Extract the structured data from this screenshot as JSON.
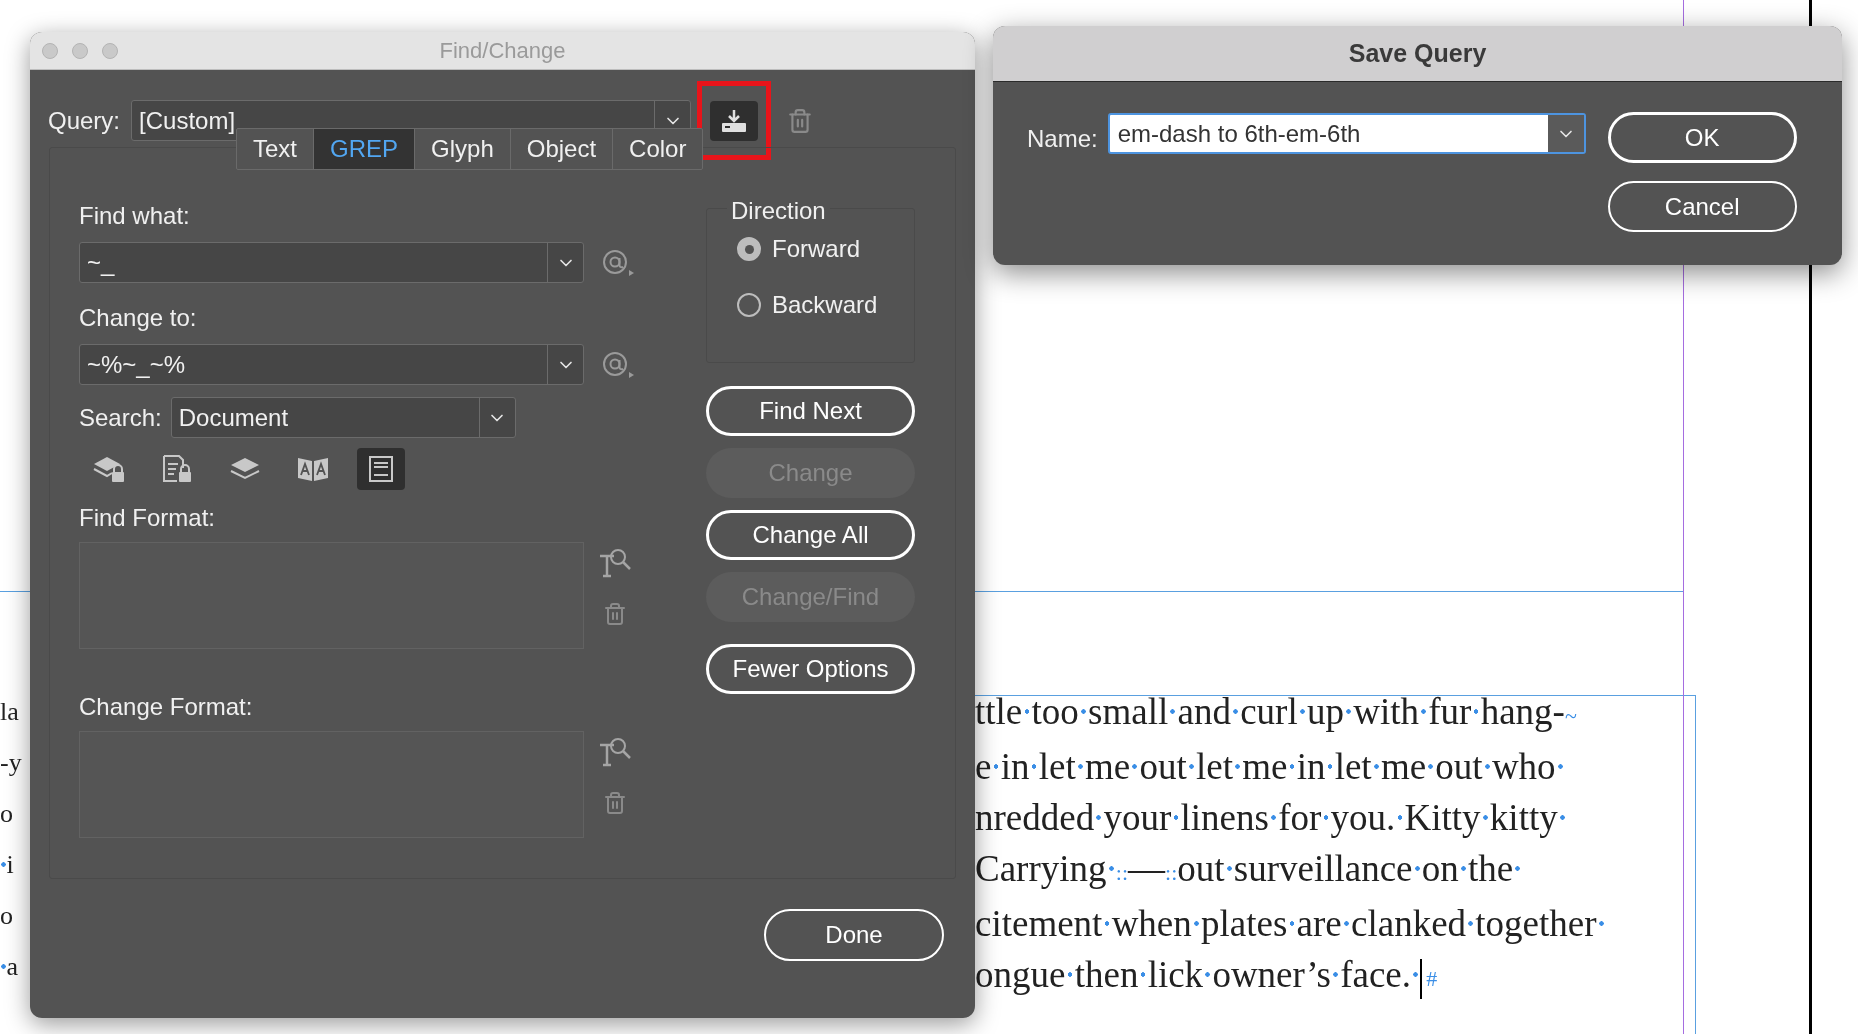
{
  "find_change": {
    "title": "Find/Change",
    "query": {
      "label": "Query:",
      "value": "[Custom]"
    },
    "save_button": {
      "highlighted": true
    },
    "tabs": [
      {
        "label": "Text",
        "selected": false
      },
      {
        "label": "GREP",
        "selected": true
      },
      {
        "label": "Glyph",
        "selected": false
      },
      {
        "label": "Object",
        "selected": false
      },
      {
        "label": "Color",
        "selected": false
      }
    ],
    "find_what": {
      "label": "Find what:",
      "value": "~_"
    },
    "change_to": {
      "label": "Change to:",
      "value": "~%~_~%"
    },
    "search": {
      "label": "Search:",
      "value": "Document"
    },
    "options": [
      {
        "kind": "lockedlayers",
        "selected": false
      },
      {
        "kind": "lockedstories",
        "selected": false
      },
      {
        "kind": "layers",
        "selected": false
      },
      {
        "kind": "masters",
        "selected": false
      },
      {
        "kind": "footnotes",
        "selected": true
      }
    ],
    "find_format": {
      "label": "Find Format:"
    },
    "change_format": {
      "label": "Change Format:"
    },
    "direction": {
      "label": "Direction",
      "options": [
        {
          "label": "Forward",
          "selected": true
        },
        {
          "label": "Backward",
          "selected": false
        }
      ]
    },
    "buttons": [
      {
        "label": "Find Next",
        "disabled": false
      },
      {
        "label": "Change",
        "disabled": true
      },
      {
        "label": "Change All",
        "disabled": false
      },
      {
        "label": "Change/Find",
        "disabled": true
      },
      {
        "label": "Fewer Options",
        "disabled": false
      }
    ],
    "done": "Done"
  },
  "save_query": {
    "title": "Save Query",
    "name_label": "Name:",
    "name_value": "em-dash to 6th-em-6th",
    "buttons": [
      "OK",
      "Cancel"
    ]
  },
  "document": {
    "left_lines": [
      {
        "parts": [
          {
            "kind": "word",
            "text": "la"
          }
        ]
      },
      {
        "parts": [
          {
            "kind": "word",
            "text": "-y"
          }
        ]
      },
      {
        "parts": [
          {
            "kind": "word",
            "text": "o"
          }
        ]
      },
      {
        "parts": [
          {
            "kind": "word",
            "text": " i"
          }
        ]
      },
      {
        "parts": [
          {
            "kind": "word",
            "text": "o"
          }
        ]
      },
      {
        "parts": [
          {
            "kind": "word",
            "text": " a"
          }
        ]
      }
    ],
    "lines": [
      {
        "caret": false,
        "parts": [
          {
            "kind": "word",
            "text": "ttle too small and curl up with fur hang-"
          },
          {
            "kind": "marker",
            "text": "~"
          }
        ]
      },
      {
        "caret": false,
        "parts": [
          {
            "kind": "word",
            "text": "e in let me out let me in let me out who "
          }
        ]
      },
      {
        "caret": false,
        "parts": [
          {
            "kind": "word",
            "text": "nredded your linens for you. Kitty kitty "
          }
        ]
      },
      {
        "caret": false,
        "parts": [
          {
            "kind": "word",
            "text": "Carrying "
          },
          {
            "kind": "marker",
            "text": "::"
          },
          {
            "kind": "word",
            "text": "—"
          },
          {
            "kind": "marker",
            "text": "::"
          },
          {
            "kind": "word",
            "text": "out surveillance on the "
          }
        ]
      },
      {
        "caret": false,
        "parts": [
          {
            "kind": "word",
            "text": "citement when plates are clanked together "
          }
        ]
      },
      {
        "caret": true,
        "parts": [
          {
            "kind": "word",
            "text": "ongue then lick owner’s face. "
          },
          {
            "kind": "marker",
            "text": "#"
          }
        ]
      }
    ]
  }
}
